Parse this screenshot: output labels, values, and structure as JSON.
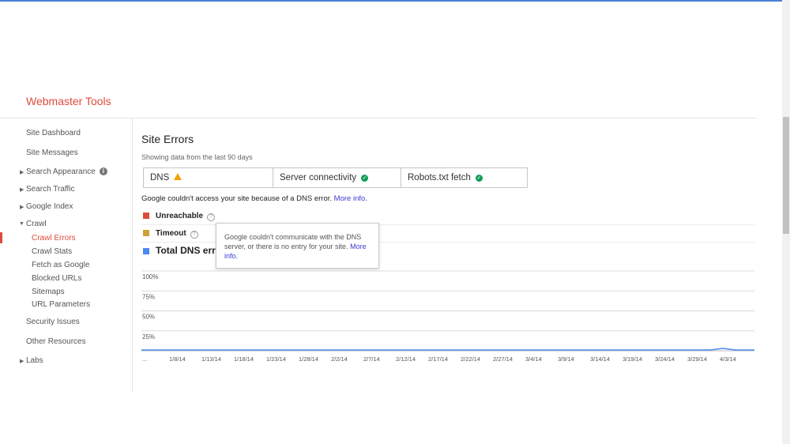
{
  "app": {
    "title": "Webmaster Tools"
  },
  "sidebar": {
    "items": [
      {
        "label": "Site Dashboard",
        "expandable": false
      },
      {
        "label": "Site Messages",
        "expandable": false
      },
      {
        "label": "Search Appearance",
        "expandable": true,
        "info_icon": "info-icon"
      },
      {
        "label": "Search Traffic",
        "expandable": true
      },
      {
        "label": "Google Index",
        "expandable": true
      },
      {
        "label": "Crawl",
        "expandable": true,
        "expanded": true,
        "children": [
          {
            "label": "Crawl Errors",
            "active": true
          },
          {
            "label": "Crawl Stats"
          },
          {
            "label": "Fetch as Google"
          },
          {
            "label": "Blocked URLs"
          },
          {
            "label": "Sitemaps"
          },
          {
            "label": "URL Parameters"
          }
        ]
      },
      {
        "label": "Security Issues",
        "expandable": false
      },
      {
        "label": "Other Resources",
        "expandable": false
      },
      {
        "label": "Labs",
        "expandable": true
      }
    ]
  },
  "main": {
    "title": "Site Errors",
    "subtitle": "Showing data from the last 90 days",
    "tabs": [
      {
        "label": "DNS",
        "status_icon": "warning-icon",
        "selected": true
      },
      {
        "label": "Server connectivity",
        "status_icon": "check-icon"
      },
      {
        "label": "Robots.txt fetch",
        "status_icon": "check-icon"
      }
    ],
    "message": {
      "text": "Google couldn't access your site because of a DNS error.",
      "link": "More info."
    },
    "legend": [
      {
        "label": "Unreachable",
        "color": "#dd4b39"
      },
      {
        "label": "Timeout",
        "color": "#d0a035"
      },
      {
        "label": "Total DNS err",
        "color": "#4a8af4"
      }
    ],
    "tooltip": {
      "text": "Google couldn't communicate with the DNS server, or there is no entry for your site.",
      "link": "More info."
    }
  },
  "chart_data": {
    "type": "line",
    "y_ticks": [
      "100%",
      "75%",
      "50%",
      "25%"
    ],
    "x_ticks": [
      "...",
      "1/8/14",
      "1/13/14",
      "1/18/14",
      "1/23/14",
      "1/28/14",
      "2/2/14",
      "2/7/14",
      "2/12/14",
      "2/17/14",
      "2/22/14",
      "2/27/14",
      "3/4/14",
      "3/9/14",
      "3/14/14",
      "3/19/14",
      "3/24/14",
      "3/29/14",
      "4/3/14"
    ],
    "ylim": [
      0,
      100
    ],
    "series": [
      {
        "name": "Total DNS err",
        "color": "#4a8af4",
        "values": [
          0,
          0,
          0,
          0,
          0,
          0,
          0,
          0,
          0,
          0,
          0,
          0,
          0,
          0,
          0,
          0,
          0,
          0,
          0,
          0,
          0,
          0,
          0,
          0,
          0,
          0,
          0,
          0,
          0,
          0,
          0,
          0,
          0,
          0,
          0,
          0,
          0,
          0,
          0,
          0,
          0,
          0,
          0,
          0,
          0,
          0,
          0,
          0,
          0,
          0,
          0,
          0,
          0,
          0,
          0,
          0,
          0,
          0,
          0,
          0,
          0,
          0,
          0,
          0,
          0,
          0,
          0,
          0,
          0,
          0,
          0,
          0,
          0,
          0,
          0,
          0,
          0,
          0,
          0,
          0,
          0,
          0,
          0,
          0,
          0,
          0,
          0,
          0,
          0,
          0,
          0,
          1,
          2,
          1,
          0,
          0,
          0,
          0
        ]
      }
    ]
  }
}
